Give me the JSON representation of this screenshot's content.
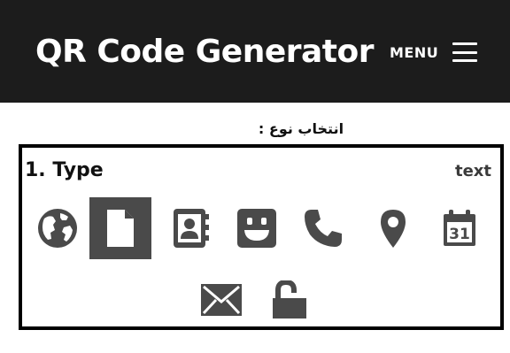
{
  "header": {
    "title": "QR Code Generator",
    "menu_label": "MENU"
  },
  "form": {
    "select_type_label": "انتخاب نوع :",
    "section_title": "1. Type",
    "selected_type": "text"
  },
  "types": [
    {
      "name": "url",
      "icon": "globe-icon",
      "selected": false
    },
    {
      "name": "text",
      "icon": "document-icon",
      "selected": true
    },
    {
      "name": "contact",
      "icon": "contact-card-icon",
      "selected": false
    },
    {
      "name": "sms",
      "icon": "smiley-icon",
      "selected": false
    },
    {
      "name": "phone",
      "icon": "phone-icon",
      "selected": false
    },
    {
      "name": "location",
      "icon": "map-pin-icon",
      "selected": false
    },
    {
      "name": "event",
      "icon": "calendar-icon",
      "selected": false,
      "calendar_day": "31"
    },
    {
      "name": "email",
      "icon": "envelope-icon",
      "selected": false
    },
    {
      "name": "wifi",
      "icon": "unlock-icon",
      "selected": false
    }
  ],
  "colors": {
    "header_bg": "#1c1c1c",
    "icon": "#4a4a4a",
    "active_bg": "#4a4a4a",
    "active_icon": "#ffffff",
    "border": "#000000"
  }
}
